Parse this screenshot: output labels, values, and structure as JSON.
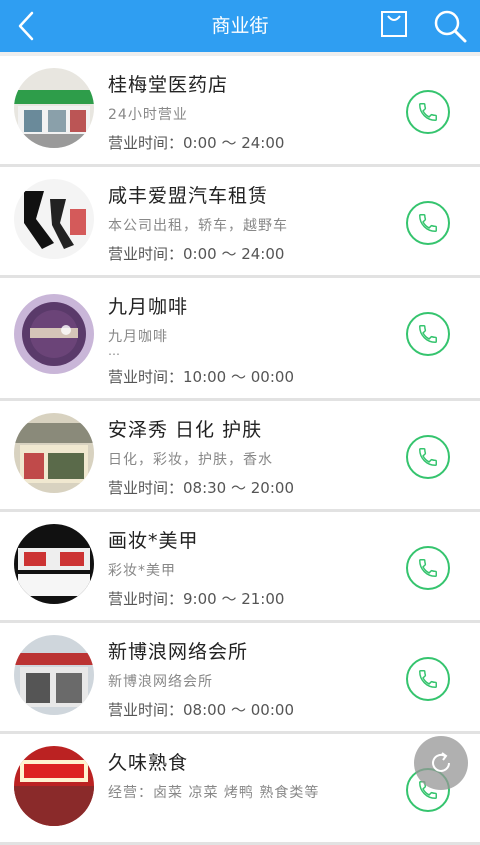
{
  "header": {
    "title": "商业街",
    "back_icon": "chevron-left-icon",
    "bag_icon": "bag-icon",
    "search_icon": "search-icon"
  },
  "colors": {
    "header_bg": "#2f9ef2",
    "call_green": "#35c46e"
  },
  "shops": [
    {
      "name": "桂梅堂医药店",
      "desc": "24小时营业",
      "hours": "营业时间：0:00  ～  24:00"
    },
    {
      "name": "咸丰爱盟汽车租赁",
      "desc": "本公司出租，轿车，越野车",
      "hours": "营业时间：0:00  ～  24:00"
    },
    {
      "name": "九月咖啡",
      "desc": "九月咖啡",
      "desc_more": "…",
      "hours": "营业时间：10:00  ～  00:00"
    },
    {
      "name": "安泽秀  日化  护肤",
      "desc": "日化，彩妆，护肤，香水",
      "hours": "营业时间：08:30  ～  20:00"
    },
    {
      "name": "画妆*美甲",
      "desc": "彩妆*美甲",
      "hours": "营业时间：9:00  ～  21:00"
    },
    {
      "name": "新博浪网络会所",
      "desc": "新博浪网络会所",
      "hours": "营业时间：08:00  ～  00:00"
    },
    {
      "name": "久味熟食",
      "desc": "经营：卤菜  凉菜  烤鸭  熟食类等",
      "hours": ""
    }
  ],
  "refresh_icon": "refresh-icon"
}
